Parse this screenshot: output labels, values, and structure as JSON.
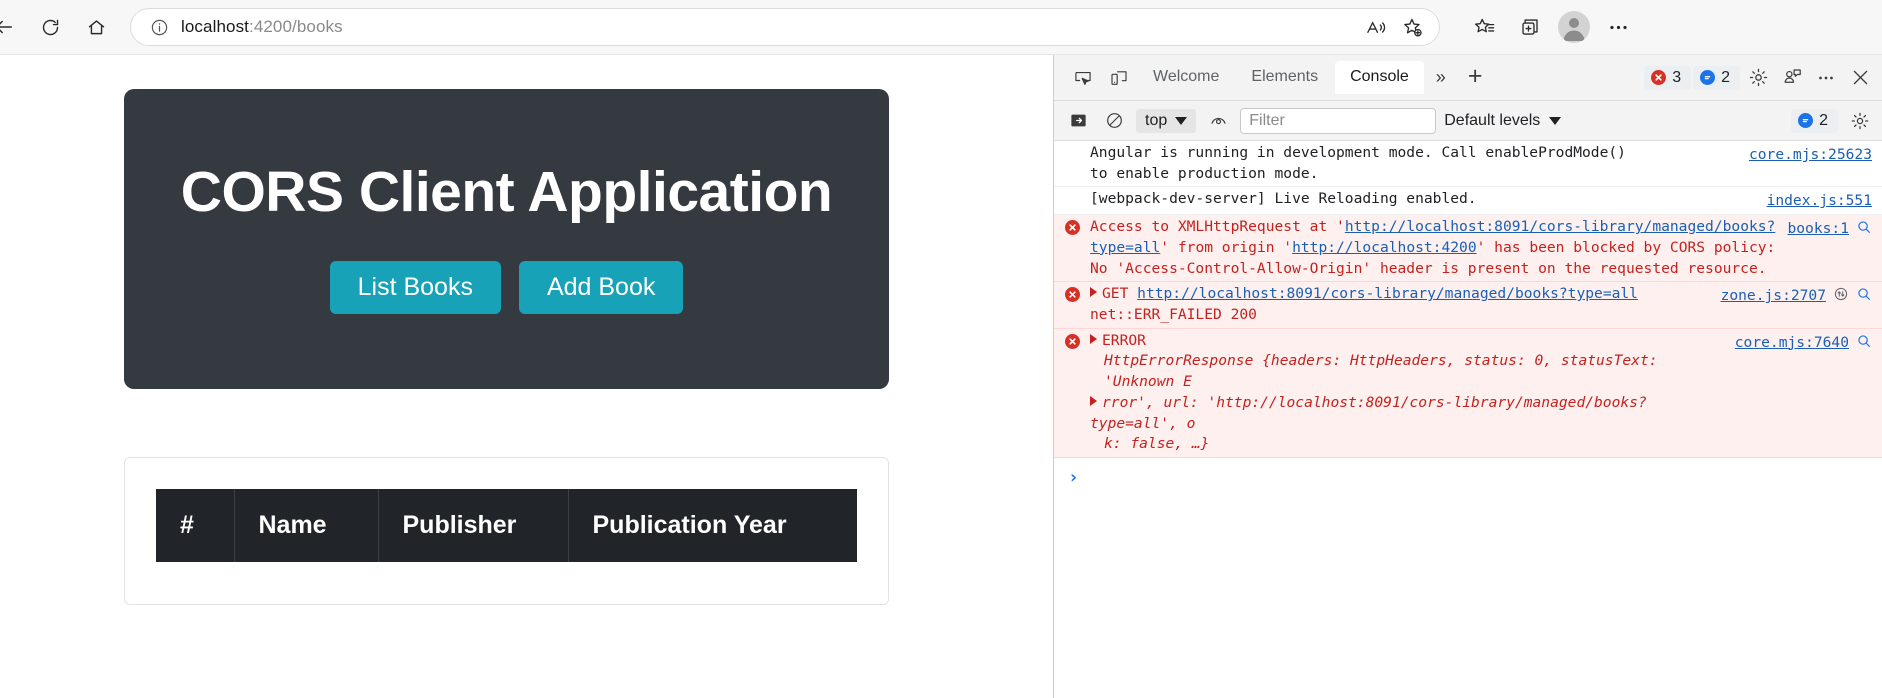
{
  "browser": {
    "back_label": "Back",
    "refresh_label": "Refresh",
    "home_label": "Home",
    "url_host": "localhost",
    "url_path": ":4200/books",
    "url_full": "localhost:4200/books",
    "site_info_label": "View site information",
    "read_aloud_label": "Read aloud",
    "add_favorite_label": "Add this page to favorites",
    "favorites_label": "Favorites",
    "collections_label": "Collections",
    "profile_label": "Profile",
    "settings_label": "Settings and more"
  },
  "page": {
    "hero_title": "CORS Client Application",
    "buttons": {
      "list_books": "List Books",
      "add_book": "Add Book"
    },
    "table": {
      "headers": [
        "#",
        "Name",
        "Publisher",
        "Publication Year"
      ],
      "rows": []
    }
  },
  "devtools": {
    "inspect_label": "Inspect element",
    "device_toolbar_label": "Toggle device toolbar",
    "tabs": [
      {
        "label": "Welcome",
        "active": false
      },
      {
        "label": "Elements",
        "active": false
      },
      {
        "label": "Console",
        "active": true
      }
    ],
    "more_tabs_label": "»",
    "new_tab_label": "+",
    "error_badge_count": "3",
    "info_badge_count": "2",
    "settings_label": "Settings",
    "feedback_label": "Send feedback",
    "more_options_label": "More options",
    "close_label": "Close DevTools",
    "toolbar": {
      "sidebar_label": "Show console sidebar",
      "clear_label": "Clear console",
      "context": "top",
      "live_expression_label": "Create live expression",
      "filter_placeholder": "Filter",
      "filter_value": "",
      "levels": "Default levels",
      "issues_count": "2",
      "console_settings_label": "Console settings"
    },
    "messages": [
      {
        "type": "log",
        "text_a": "Angular is running in development mode. Call enableProdMode()",
        "text_b": "to enable production mode.",
        "source": "core.mjs:25623"
      },
      {
        "type": "log",
        "text_a": "[webpack-dev-server] Live Reloading enabled.",
        "text_b": "",
        "source": "index.js:551"
      },
      {
        "type": "error",
        "prefix": "Access to XMLHttpRequest at '",
        "url1": "http://localhost:8091/cors-library/managed/books?type=all",
        "mid": "' from origin '",
        "url2": "http://localhost:4200",
        "suffix": "' has been blocked by CORS policy: No 'Access-Control-Allow-Origin' header is present on the requested resource.",
        "source": "books:1"
      },
      {
        "type": "error",
        "method": "GET",
        "url1": "http://localhost:8091/cors-library/managed/books?type=all",
        "suffix": " net::ERR_FAILED 200",
        "source": "zone.js:2707"
      },
      {
        "type": "error",
        "label": "ERROR",
        "detail_a": "HttpErrorResponse {headers: HttpHeaders, status: 0, statusText: 'Unknown E",
        "detail_b": "rror', url: 'http://localhost:8091/cors-library/managed/books?type=all', o",
        "detail_c": "k: false, …}",
        "source": "core.mjs:7640"
      }
    ],
    "prompt_symbol": "›"
  },
  "colors": {
    "accent_teal": "#17a2b8",
    "hero_dark": "#343a40",
    "table_header": "#212529",
    "error_red": "#d93025",
    "error_text": "#c5221f",
    "link_blue": "#1a5fb4",
    "info_blue": "#1a73e8"
  }
}
